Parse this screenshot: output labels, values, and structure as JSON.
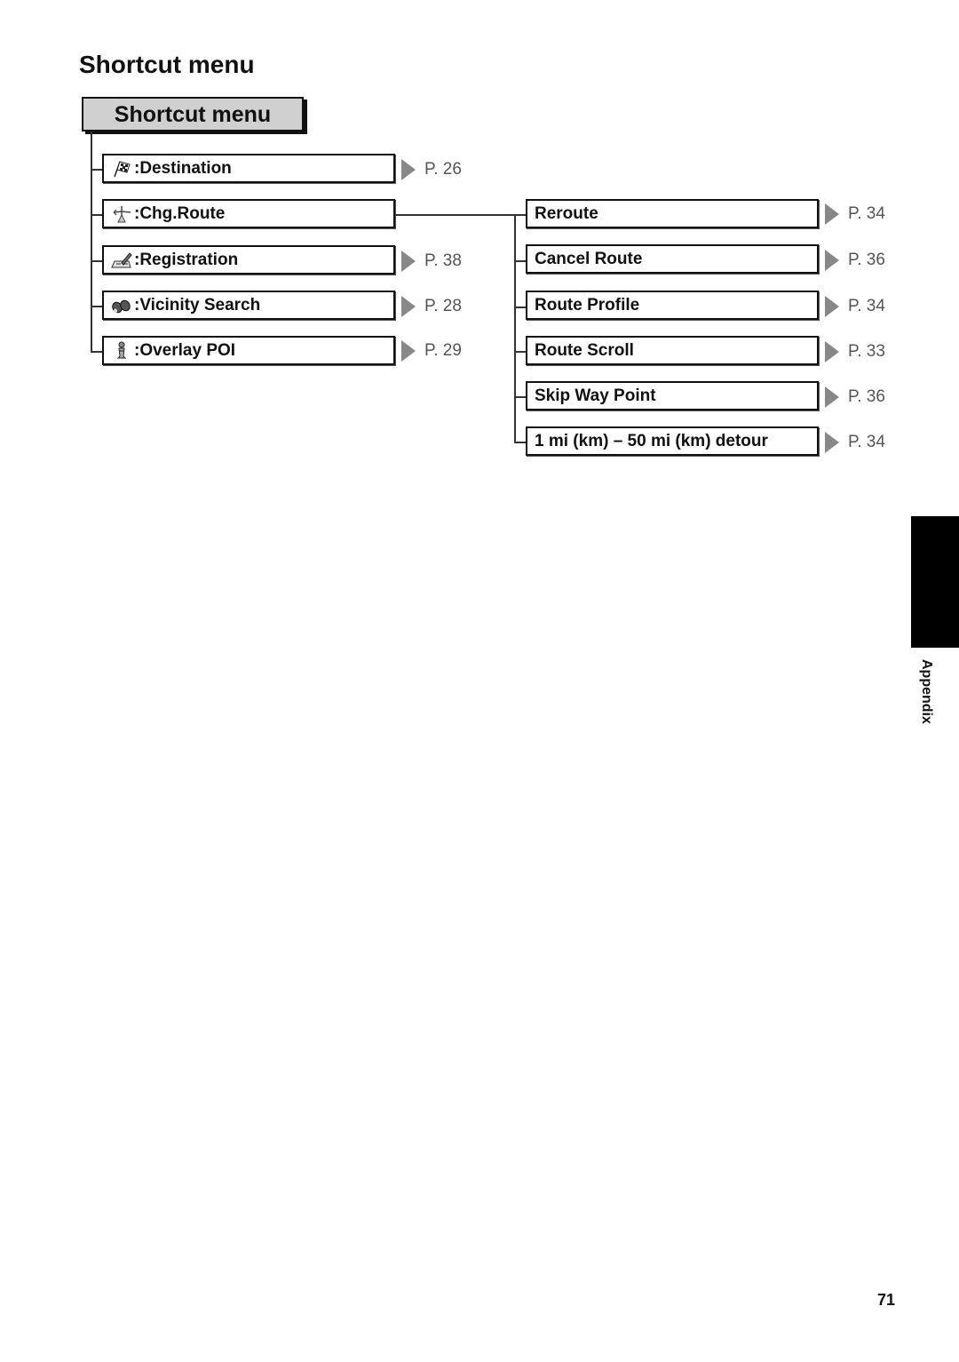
{
  "page": {
    "heading": "Shortcut menu",
    "menu_header": "Shortcut menu",
    "side_tab_label": "Appendix",
    "page_number": "71"
  },
  "left_items": [
    {
      "icon": "checkered-flag-icon",
      "label": ":Destination",
      "ref": "P. 26"
    },
    {
      "icon": "route-change-icon",
      "label": ":Chg.Route",
      "ref": ""
    },
    {
      "icon": "registration-book-icon",
      "label": ":Registration",
      "ref": "P. 38"
    },
    {
      "icon": "binoculars-icon",
      "label": ":Vicinity Search",
      "ref": "P. 28"
    },
    {
      "icon": "info-poi-icon",
      "label": " :Overlay POI",
      "ref": "P. 29"
    }
  ],
  "right_items": [
    {
      "label": "Reroute",
      "ref": "P. 34"
    },
    {
      "label": "Cancel Route",
      "ref": "P. 36"
    },
    {
      "label": "Route Profile",
      "ref": "P. 34"
    },
    {
      "label": "Route Scroll",
      "ref": "P. 33"
    },
    {
      "label": "Skip Way Point",
      "ref": "P. 36"
    },
    {
      "label": "1 mi (km) – 50 mi (km) detour",
      "ref": "P. 34"
    }
  ]
}
